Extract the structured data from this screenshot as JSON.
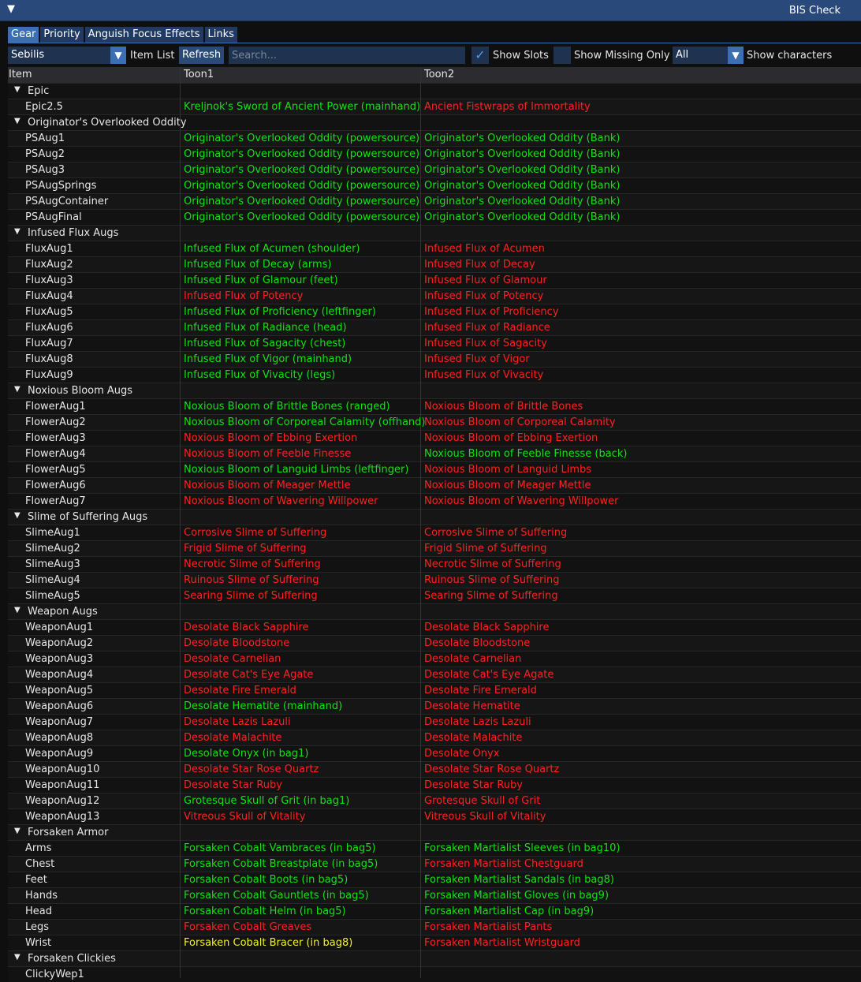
{
  "window": {
    "title": "BIS Check"
  },
  "tabs": [
    "Gear",
    "Priority",
    "Anguish Focus Effects",
    "Links"
  ],
  "toolbar": {
    "item_list_selected": "Sebilis",
    "item_list_label": "Item List",
    "refresh_label": "Refresh",
    "search_placeholder": "Search...",
    "show_slots_label": "Show Slots",
    "show_missing_label": "Show Missing Only",
    "characters_selected": "All",
    "show_characters_label": "Show characters"
  },
  "table": {
    "headers": [
      "Item",
      "Toon1",
      "Toon2"
    ],
    "rows": [
      {
        "group": "Epic"
      },
      {
        "item": "Epic2.5",
        "t1": "Kreljnok's Sword of Ancient Power (mainhand)",
        "s1": "green",
        "t2": "Ancient Fistwraps of Immortality",
        "s2": "red"
      },
      {
        "group": "Originator's Overlooked Oddity"
      },
      {
        "item": "PSAug1",
        "t1": "Originator's Overlooked Oddity (powersource)",
        "s1": "green",
        "t2": "Originator's Overlooked Oddity (Bank)",
        "s2": "green"
      },
      {
        "item": "PSAug2",
        "t1": "Originator's Overlooked Oddity (powersource)",
        "s1": "green",
        "t2": "Originator's Overlooked Oddity (Bank)",
        "s2": "green"
      },
      {
        "item": "PSAug3",
        "t1": "Originator's Overlooked Oddity (powersource)",
        "s1": "green",
        "t2": "Originator's Overlooked Oddity (Bank)",
        "s2": "green"
      },
      {
        "item": "PSAugSprings",
        "t1": "Originator's Overlooked Oddity (powersource)",
        "s1": "green",
        "t2": "Originator's Overlooked Oddity (Bank)",
        "s2": "green"
      },
      {
        "item": "PSAugContainer",
        "t1": "Originator's Overlooked Oddity (powersource)",
        "s1": "green",
        "t2": "Originator's Overlooked Oddity (Bank)",
        "s2": "green"
      },
      {
        "item": "PSAugFinal",
        "t1": "Originator's Overlooked Oddity (powersource)",
        "s1": "green",
        "t2": "Originator's Overlooked Oddity (Bank)",
        "s2": "green"
      },
      {
        "group": "Infused Flux Augs"
      },
      {
        "item": "FluxAug1",
        "t1": "Infused Flux of Acumen (shoulder)",
        "s1": "green",
        "t2": "Infused Flux of Acumen",
        "s2": "red"
      },
      {
        "item": "FluxAug2",
        "t1": "Infused Flux of Decay (arms)",
        "s1": "green",
        "t2": "Infused Flux of Decay",
        "s2": "red"
      },
      {
        "item": "FluxAug3",
        "t1": "Infused Flux of Glamour (feet)",
        "s1": "green",
        "t2": "Infused Flux of Glamour",
        "s2": "red"
      },
      {
        "item": "FluxAug4",
        "t1": "Infused Flux of Potency",
        "s1": "red",
        "t2": "Infused Flux of Potency",
        "s2": "red"
      },
      {
        "item": "FluxAug5",
        "t1": "Infused Flux of Proficiency (leftfinger)",
        "s1": "green",
        "t2": "Infused Flux of Proficiency",
        "s2": "red"
      },
      {
        "item": "FluxAug6",
        "t1": "Infused Flux of Radiance (head)",
        "s1": "green",
        "t2": "Infused Flux of Radiance",
        "s2": "red"
      },
      {
        "item": "FluxAug7",
        "t1": "Infused Flux of Sagacity (chest)",
        "s1": "green",
        "t2": "Infused Flux of Sagacity",
        "s2": "red"
      },
      {
        "item": "FluxAug8",
        "t1": "Infused Flux of Vigor (mainhand)",
        "s1": "green",
        "t2": "Infused Flux of Vigor",
        "s2": "red"
      },
      {
        "item": "FluxAug9",
        "t1": "Infused Flux of Vivacity (legs)",
        "s1": "green",
        "t2": "Infused Flux of Vivacity",
        "s2": "red"
      },
      {
        "group": "Noxious Bloom Augs"
      },
      {
        "item": "FlowerAug1",
        "t1": "Noxious Bloom of Brittle Bones (ranged)",
        "s1": "green",
        "t2": "Noxious Bloom of Brittle Bones",
        "s2": "red"
      },
      {
        "item": "FlowerAug2",
        "t1": "Noxious Bloom of Corporeal Calamity (offhand)",
        "s1": "green",
        "t2": "Noxious Bloom of Corporeal Calamity",
        "s2": "red"
      },
      {
        "item": "FlowerAug3",
        "t1": "Noxious Bloom of Ebbing Exertion",
        "s1": "red",
        "t2": "Noxious Bloom of Ebbing Exertion",
        "s2": "red"
      },
      {
        "item": "FlowerAug4",
        "t1": "Noxious Bloom of Feeble Finesse",
        "s1": "red",
        "t2": "Noxious Bloom of Feeble Finesse (back)",
        "s2": "green"
      },
      {
        "item": "FlowerAug5",
        "t1": "Noxious Bloom of Languid Limbs (leftfinger)",
        "s1": "green",
        "t2": "Noxious Bloom of Languid Limbs",
        "s2": "red"
      },
      {
        "item": "FlowerAug6",
        "t1": "Noxious Bloom of Meager Mettle",
        "s1": "red",
        "t2": "Noxious Bloom of Meager Mettle",
        "s2": "red"
      },
      {
        "item": "FlowerAug7",
        "t1": "Noxious Bloom of Wavering Willpower",
        "s1": "red",
        "t2": "Noxious Bloom of Wavering Willpower",
        "s2": "red"
      },
      {
        "group": "Slime of Suffering Augs"
      },
      {
        "item": "SlimeAug1",
        "t1": "Corrosive Slime of Suffering",
        "s1": "red",
        "t2": "Corrosive Slime of Suffering",
        "s2": "red"
      },
      {
        "item": "SlimeAug2",
        "t1": "Frigid Slime of Suffering",
        "s1": "red",
        "t2": "Frigid Slime of Suffering",
        "s2": "red"
      },
      {
        "item": "SlimeAug3",
        "t1": "Necrotic Slime of Suffering",
        "s1": "red",
        "t2": "Necrotic Slime of Suffering",
        "s2": "red"
      },
      {
        "item": "SlimeAug4",
        "t1": "Ruinous Slime of Suffering",
        "s1": "red",
        "t2": "Ruinous Slime of Suffering",
        "s2": "red"
      },
      {
        "item": "SlimeAug5",
        "t1": "Searing Slime of Suffering",
        "s1": "red",
        "t2": "Searing Slime of Suffering",
        "s2": "red"
      },
      {
        "group": "Weapon Augs"
      },
      {
        "item": "WeaponAug1",
        "t1": "Desolate Black Sapphire",
        "s1": "red",
        "t2": "Desolate Black Sapphire",
        "s2": "red"
      },
      {
        "item": "WeaponAug2",
        "t1": "Desolate Bloodstone",
        "s1": "red",
        "t2": "Desolate Bloodstone",
        "s2": "red"
      },
      {
        "item": "WeaponAug3",
        "t1": "Desolate Carnelian",
        "s1": "red",
        "t2": "Desolate Carnelian",
        "s2": "red"
      },
      {
        "item": "WeaponAug4",
        "t1": "Desolate Cat's Eye Agate",
        "s1": "red",
        "t2": "Desolate Cat's Eye Agate",
        "s2": "red"
      },
      {
        "item": "WeaponAug5",
        "t1": "Desolate Fire Emerald",
        "s1": "red",
        "t2": "Desolate Fire Emerald",
        "s2": "red"
      },
      {
        "item": "WeaponAug6",
        "t1": "Desolate Hematite (mainhand)",
        "s1": "green",
        "t2": "Desolate Hematite",
        "s2": "red"
      },
      {
        "item": "WeaponAug7",
        "t1": "Desolate Lazis Lazuli",
        "s1": "red",
        "t2": "Desolate Lazis Lazuli",
        "s2": "red"
      },
      {
        "item": "WeaponAug8",
        "t1": "Desolate Malachite",
        "s1": "red",
        "t2": "Desolate Malachite",
        "s2": "red"
      },
      {
        "item": "WeaponAug9",
        "t1": "Desolate Onyx (in bag1)",
        "s1": "green",
        "t2": "Desolate Onyx",
        "s2": "red"
      },
      {
        "item": "WeaponAug10",
        "t1": "Desolate Star Rose Quartz",
        "s1": "red",
        "t2": "Desolate Star Rose Quartz",
        "s2": "red"
      },
      {
        "item": "WeaponAug11",
        "t1": "Desolate Star Ruby",
        "s1": "red",
        "t2": "Desolate Star Ruby",
        "s2": "red"
      },
      {
        "item": "WeaponAug12",
        "t1": "Grotesque Skull of Grit (in bag1)",
        "s1": "green",
        "t2": "Grotesque Skull of Grit",
        "s2": "red"
      },
      {
        "item": "WeaponAug13",
        "t1": "Vitreous Skull of Vitality",
        "s1": "red",
        "t2": "Vitreous Skull of Vitality",
        "s2": "red"
      },
      {
        "group": "Forsaken Armor"
      },
      {
        "item": "Arms",
        "t1": "Forsaken Cobalt Vambraces (in bag5)",
        "s1": "green",
        "t2": "Forsaken Martialist Sleeves (in bag10)",
        "s2": "green"
      },
      {
        "item": "Chest",
        "t1": "Forsaken Cobalt Breastplate (in bag5)",
        "s1": "green",
        "t2": "Forsaken Martialist Chestguard",
        "s2": "red"
      },
      {
        "item": "Feet",
        "t1": "Forsaken Cobalt Boots (in bag5)",
        "s1": "green",
        "t2": "Forsaken Martialist Sandals (in bag8)",
        "s2": "green"
      },
      {
        "item": "Hands",
        "t1": "Forsaken Cobalt Gauntlets (in bag5)",
        "s1": "green",
        "t2": "Forsaken Martialist Gloves (in bag9)",
        "s2": "green"
      },
      {
        "item": "Head",
        "t1": "Forsaken Cobalt Helm (in bag5)",
        "s1": "green",
        "t2": "Forsaken Martialist Cap (in bag9)",
        "s2": "green"
      },
      {
        "item": "Legs",
        "t1": "Forsaken Cobalt Greaves",
        "s1": "red",
        "t2": "Forsaken Martialist Pants",
        "s2": "red"
      },
      {
        "item": "Wrist",
        "t1": "Forsaken Cobalt Bracer (in bag8)",
        "s1": "yellow",
        "t2": "Forsaken Martialist Wristguard",
        "s2": "red"
      },
      {
        "group": "Forsaken Clickies"
      },
      {
        "item": "ClickyWep1",
        "t1": "",
        "s1": "red",
        "t2": "",
        "s2": "red"
      }
    ]
  }
}
